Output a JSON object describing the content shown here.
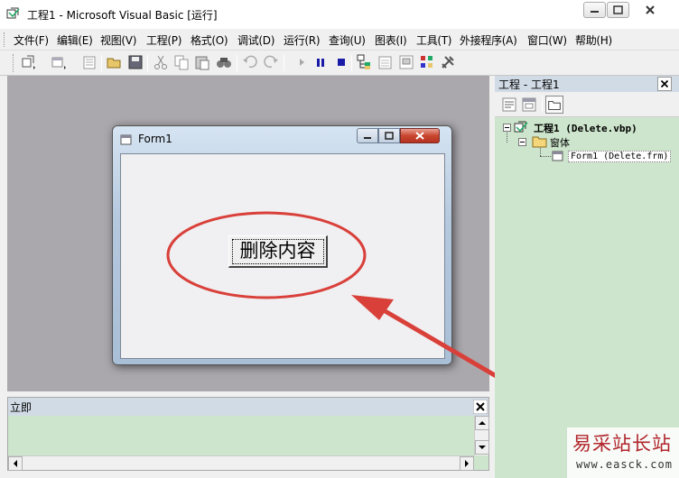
{
  "window": {
    "title": "工程1 - Microsoft Visual Basic [运行]",
    "icon": "vb6-app-icon"
  },
  "menubar": {
    "items": [
      {
        "label": "文件(F)"
      },
      {
        "label": "编辑(E)"
      },
      {
        "label": "视图(V)"
      },
      {
        "label": "工程(P)"
      },
      {
        "label": "格式(O)"
      },
      {
        "label": "调试(D)"
      },
      {
        "label": "运行(R)"
      },
      {
        "label": "查询(U)"
      },
      {
        "label": "图表(I)"
      },
      {
        "label": "工具(T)"
      },
      {
        "label": "外接程序(A)"
      },
      {
        "label": "窗口(W)"
      },
      {
        "label": "帮助(H)"
      }
    ]
  },
  "toolbar": {
    "icons": [
      "add-project-icon",
      "add-form-icon",
      "menu-editor-icon",
      "open-icon",
      "save-icon",
      "cut-icon",
      "copy-icon",
      "paste-icon",
      "find-icon",
      "undo-icon",
      "redo-icon",
      "start-icon",
      "break-icon",
      "end-icon",
      "project-explorer-icon",
      "properties-icon",
      "form-layout-icon",
      "object-browser-icon",
      "toolbox-icon"
    ]
  },
  "form": {
    "title": "Form1",
    "button_label": "删除内容"
  },
  "immediate": {
    "title": "立即"
  },
  "project": {
    "title": "工程 - 工程1",
    "tree": {
      "root": "工程1 (Delete.vbp)",
      "folder": "窗体",
      "file": "Form1 (Delete.frm)"
    }
  },
  "annotation": {
    "color": "#d9403a"
  },
  "watermark": {
    "text": "易采站长站",
    "url": "www.easck.com"
  }
}
